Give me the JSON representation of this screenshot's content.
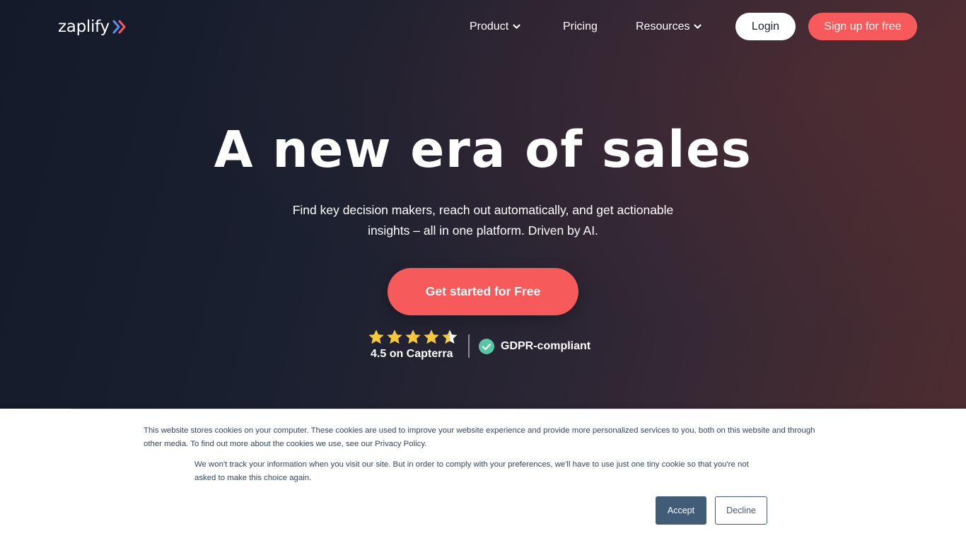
{
  "nav": {
    "logo_text": "zaplify",
    "product_label": "Product",
    "pricing_label": "Pricing",
    "resources_label": "Resources",
    "login_label": "Login",
    "signup_label": "Sign up for free"
  },
  "hero": {
    "headline": "A new era of sales",
    "subhead": "Find key decision makers, reach out automatically, and get actionable insights – all in one platform. Driven by AI.",
    "cta_label": "Get started for Free",
    "rating_text": "4.5 on Capterra",
    "rating_value": 4.5,
    "rating_max": 5,
    "gdpr_text": "GDPR-compliant"
  },
  "cookie": {
    "paragraph1": "This website stores cookies on your computer. These cookies are used to improve your website experience and provide more personalized services to you, both on this website and through other media. To find out more about the cookies we use, see our Privacy Policy.",
    "paragraph2": "We won't track your information when you visit our site. But in order to comply with your preferences, we'll have to use just one tiny cookie so that you're not asked to make this choice again.",
    "accept_label": "Accept",
    "decline_label": "Decline"
  },
  "colors": {
    "brand_coral": "#f65a5b",
    "logo_blue": "#5b8def",
    "star_yellow": "#f9c935",
    "check_green": "#55c7a6",
    "cookie_button": "#425b76"
  },
  "icons": {
    "logo_mark": "double-chevron-right-icon",
    "dropdown": "chevron-down-icon",
    "star": "star-icon",
    "check": "check-circle-icon"
  }
}
